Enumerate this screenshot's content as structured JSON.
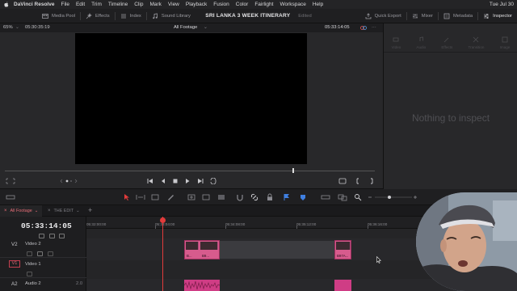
{
  "menubar": {
    "app": "DaVinci Resolve",
    "items": [
      "File",
      "Edit",
      "Trim",
      "Timeline",
      "Clip",
      "Mark",
      "View",
      "Playback",
      "Fusion",
      "Color",
      "Fairlight",
      "Workspace",
      "Help"
    ],
    "clock": "Tue Jul 30"
  },
  "toolbar": {
    "media_pool": "Media Pool",
    "effects": "Effects",
    "index": "Index",
    "sound_library": "Sound Library",
    "project_title": "SRI LANKA 3 WEEK ITINERARY",
    "edited": "Edited",
    "quick_export": "Quick Export",
    "mixer": "Mixer",
    "metadata": "Metadata",
    "inspector": "Inspector"
  },
  "viewer": {
    "zoom": "65%",
    "timecode_left": "05:30:35:19",
    "source": "All Footage",
    "timecode_right": "05:33:14:05"
  },
  "inspector": {
    "tabs": [
      "Video",
      "Audio",
      "Effects",
      "Transition",
      "Image"
    ],
    "empty_message": "Nothing to inspect"
  },
  "timeline_tabs": {
    "active": "All Footage",
    "other": "THE EDIT"
  },
  "timeline": {
    "timecode": "05:33:14:05",
    "ruler": [
      "05:32:00:00",
      "05:33:04:00",
      "05:34:08:00",
      "05:35:12:00",
      "05:36:16:00"
    ],
    "tracks": {
      "v2": {
        "id": "V2",
        "name": "Video 2"
      },
      "v1": {
        "id": "V1",
        "name": "Video 1"
      },
      "a2": {
        "id": "A2",
        "name": "Audio 2",
        "level": "2.0"
      }
    },
    "clips": {
      "c1": "B...",
      "c2": "B9...",
      "c3": "B97A..."
    }
  },
  "colors": {
    "accent_red": "#e23b3b",
    "clip_pink": "#d75b8d",
    "background": "#1b1b1d"
  }
}
